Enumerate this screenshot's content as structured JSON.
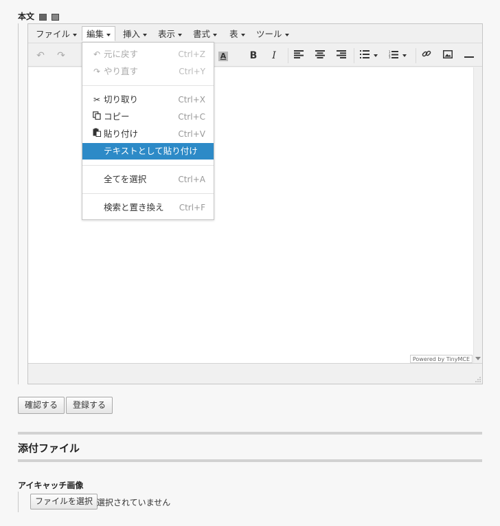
{
  "body_label": "本文",
  "editor": {
    "menubar": [
      {
        "label": "ファイル",
        "active": false
      },
      {
        "label": "編集",
        "active": true
      },
      {
        "label": "挿入",
        "active": false
      },
      {
        "label": "表示",
        "active": false
      },
      {
        "label": "書式",
        "active": false
      },
      {
        "label": "表",
        "active": false
      },
      {
        "label": "ツール",
        "active": false
      }
    ],
    "toolbar": {
      "undo_icon": "undo-icon",
      "redo_icon": "redo-icon",
      "text_color_label": "A",
      "bold_label": "B",
      "italic_label": "I"
    },
    "powered_by": "Powered by TinyMCE"
  },
  "edit_menu": {
    "items": [
      {
        "icon": "undo-icon",
        "label": "元に戻す",
        "shortcut": "Ctrl+Z",
        "disabled": true
      },
      {
        "icon": "redo-icon",
        "label": "やり直す",
        "shortcut": "Ctrl+Y",
        "disabled": true
      },
      {
        "icon": "cut-icon",
        "label": "切り取り",
        "shortcut": "Ctrl+X",
        "disabled": false
      },
      {
        "icon": "copy-icon",
        "label": "コピー",
        "shortcut": "Ctrl+C",
        "disabled": false
      },
      {
        "icon": "paste-icon",
        "label": "貼り付け",
        "shortcut": "Ctrl+V",
        "disabled": false
      },
      {
        "icon": "",
        "label": "テキストとして貼り付け",
        "shortcut": "",
        "selected": true
      },
      {
        "icon": "",
        "label": "全てを選択",
        "shortcut": "Ctrl+A",
        "disabled": false
      },
      {
        "icon": "",
        "label": "検索と置き換え",
        "shortcut": "Ctrl+F",
        "disabled": false
      }
    ]
  },
  "actions": {
    "confirm_label": "確認する",
    "register_label": "登録する"
  },
  "attachments": {
    "section_title": "添付ファイル",
    "eyecatch_label": "アイキャッチ画像",
    "choose_file_label": "ファイルを選択",
    "no_file_text": "選択されていません"
  },
  "colors": {
    "accent": "#2d8ac7",
    "background": "#f7f7f7"
  }
}
